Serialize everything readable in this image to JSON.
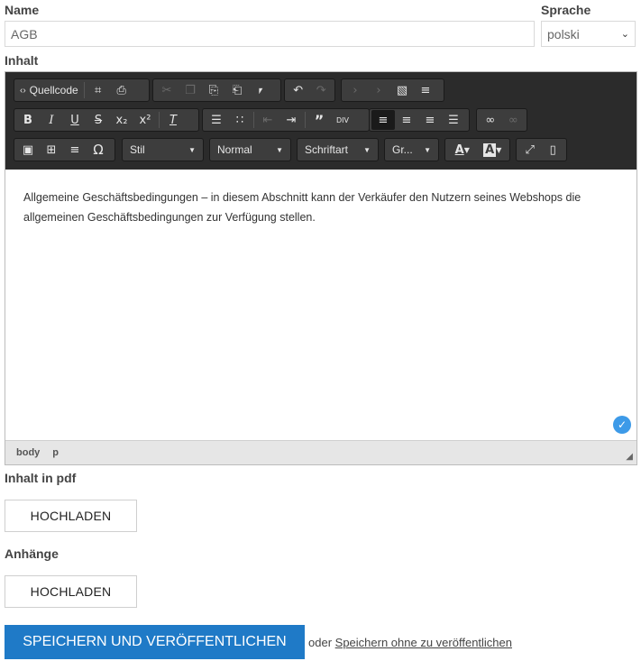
{
  "form": {
    "name_label": "Name",
    "name_value": "AGB",
    "language_label": "Sprache",
    "language_value": "polski",
    "content_label": "Inhalt",
    "pdf_label": "Inhalt in pdf",
    "attachments_label": "Anhänge",
    "upload_label": "HOCHLADEN",
    "save_publish_label": "SPEICHERN UND VERÖFFENTLICHEN",
    "or_text": "oder",
    "save_without_publish_label": "Speichern ohne zu veröffentlichen"
  },
  "editor": {
    "source_button_label": "Quellcode",
    "style_combo": "Stil",
    "format_combo": "Normal",
    "font_combo": "Schriftart",
    "size_combo": "Gr...",
    "content_text": "Allgemeine Geschäftsbedingungen – in diesem Abschnitt kann der Verkäufer den Nutzern seines Webshops die allgemeinen Geschäftsbedingungen zur Verfügung stellen.",
    "status_path": [
      "body",
      "p"
    ],
    "colors": {
      "toolbar_bg": "#2b2b2b",
      "button_bg": "#3d3d3d",
      "accent": "#1f7ac7"
    }
  }
}
